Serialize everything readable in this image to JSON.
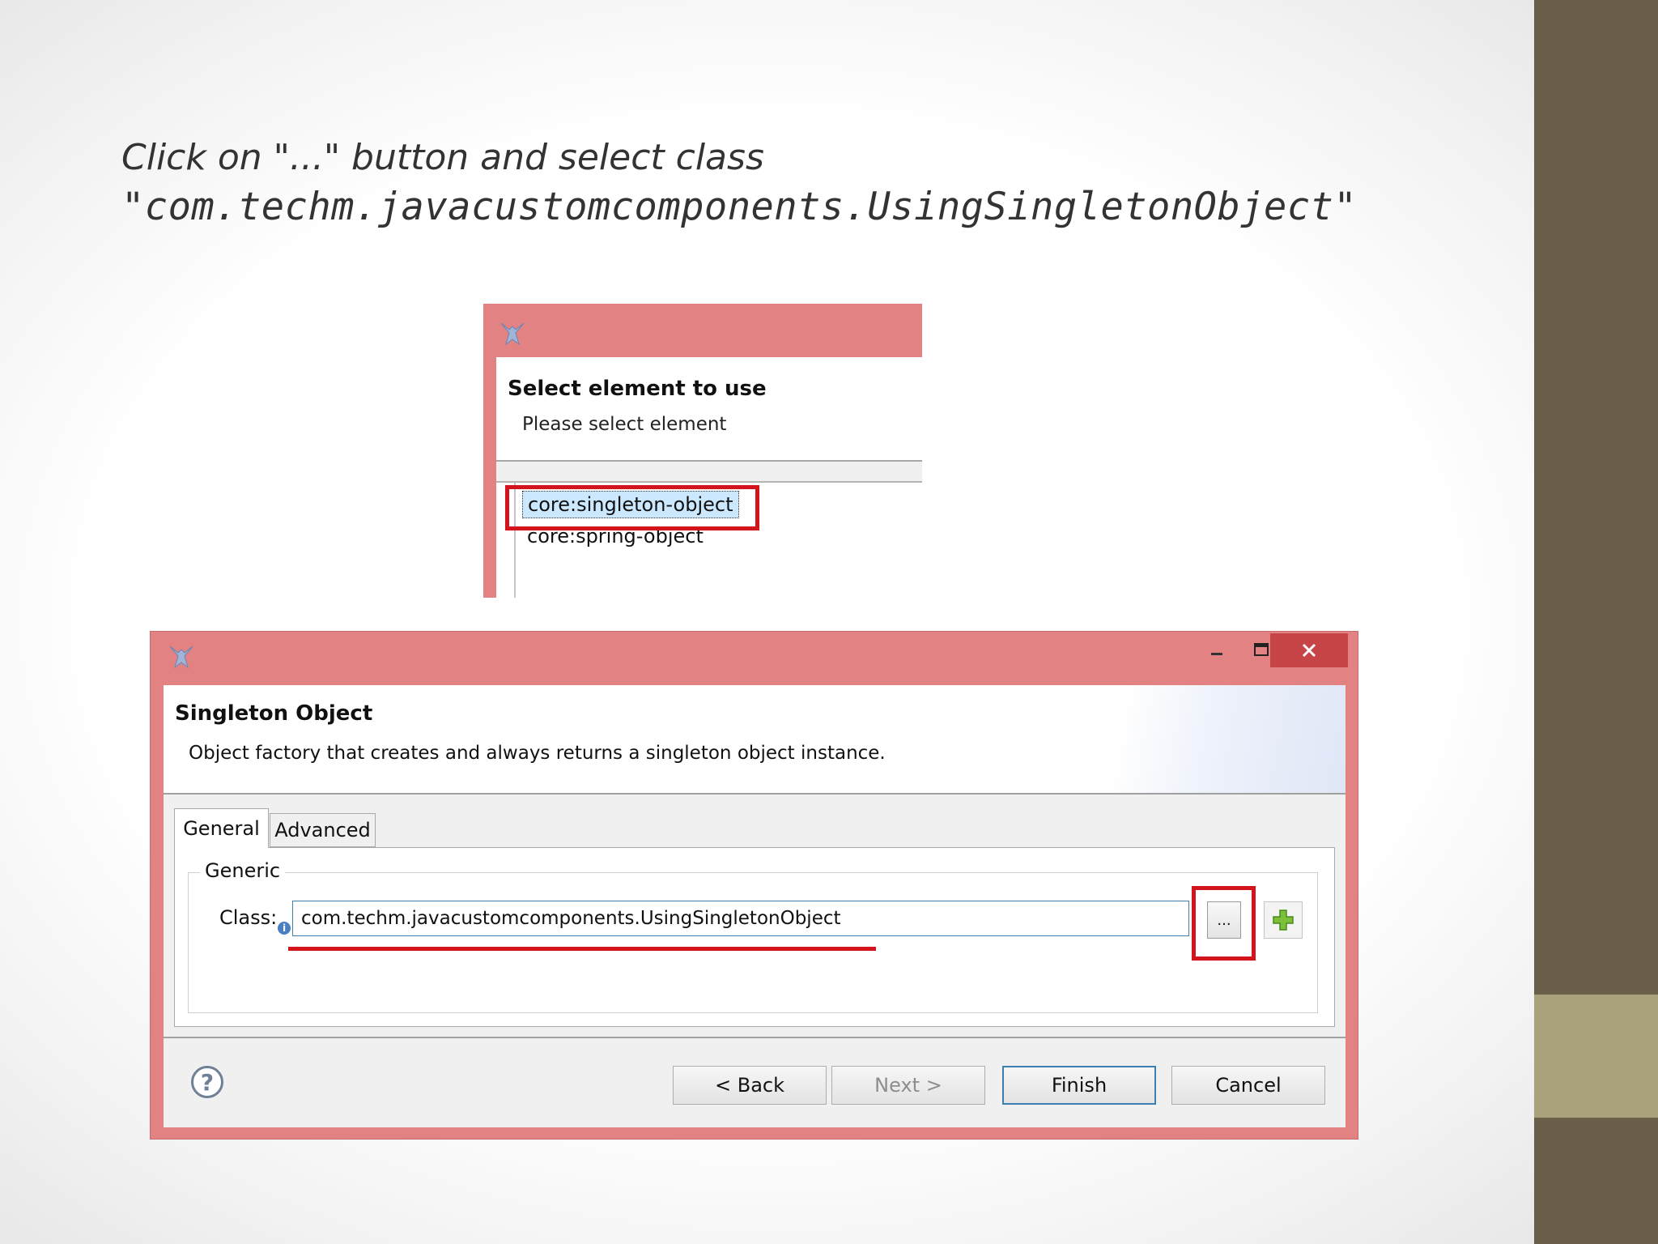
{
  "instruction": {
    "line1": "Click on \"...\" button and select class",
    "line2": "\"com.techm.javacustomcomponents.UsingSingletonObject\""
  },
  "select_dialog": {
    "title_icon": "eclipse-app-icon",
    "heading": "Select element to use",
    "subtitle": "Please select element",
    "items": [
      {
        "label": "core:singleton-object",
        "selected": true
      },
      {
        "label": "core:spring-object",
        "selected": false
      }
    ]
  },
  "main_dialog": {
    "title_icon": "eclipse-app-icon",
    "window_controls": {
      "minimize": "–",
      "maximize": "☐",
      "close": "✕"
    },
    "title": "Singleton Object",
    "description": "Object factory that creates and always returns a singleton object instance.",
    "tabs": [
      {
        "label": "General",
        "active": true
      },
      {
        "label": "Advanced",
        "active": false
      }
    ],
    "group_label": "Generic",
    "class_label": "Class:",
    "class_value": "com.techm.javacustomcomponents.UsingSingletonObject",
    "browse_label": "...",
    "add_icon": "plus-icon",
    "help_icon": "help-icon",
    "buttons": {
      "back": "< Back",
      "next": "Next >",
      "finish": "Finish",
      "cancel": "Cancel"
    }
  },
  "colors": {
    "titlebar": "#e38282",
    "close_button": "#c74447",
    "highlight_red": "#d4141d",
    "sidebar": "#6b5e48",
    "sidebar_accent": "#a9a27c"
  }
}
